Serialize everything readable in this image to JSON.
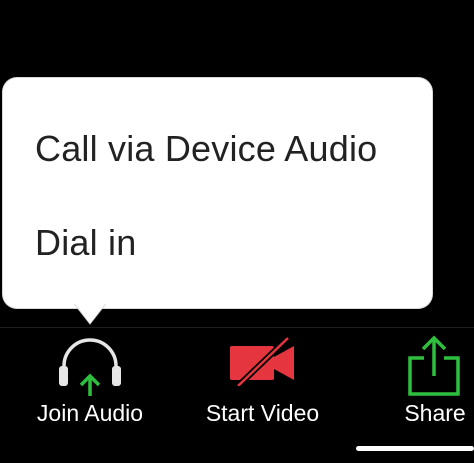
{
  "audio_menu": {
    "items": [
      {
        "label": "Call via Device Audio"
      },
      {
        "label": "Dial in"
      }
    ]
  },
  "toolbar": {
    "join_audio": {
      "label": "Join Audio",
      "icon": "headphones-icon"
    },
    "start_video": {
      "label": "Start Video",
      "icon": "video-camera-off-icon"
    },
    "share": {
      "label": "Share",
      "icon": "share-icon"
    }
  },
  "colors": {
    "background": "#000000",
    "popup": "#ffffff",
    "menu_text": "#222222",
    "join_arrow": "#2fbf3f",
    "video_red": "#e5353f",
    "share_green": "#2fbf3f"
  }
}
